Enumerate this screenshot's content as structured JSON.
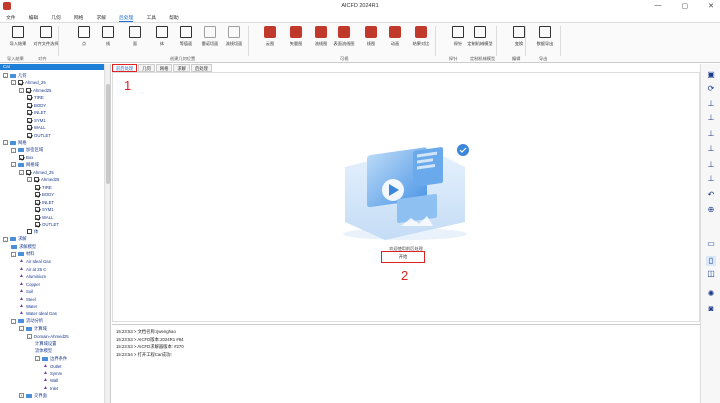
{
  "window": {
    "title": "AICFD 2024R1",
    "controls": [
      "—",
      "▢",
      "✕"
    ]
  },
  "menu": [
    "文件",
    "编辑",
    "几何",
    "网格",
    "求解",
    "后处理",
    "工具",
    "帮助"
  ],
  "menu_active_index": 5,
  "ribbon": {
    "buttons": [
      {
        "label": "导入结果",
        "icon": "import-result-icon"
      },
      {
        "label": "对齐文件选择",
        "icon": "file-select-icon"
      },
      {
        "label": "点",
        "icon": "point-icon"
      },
      {
        "label": "线",
        "icon": "line-icon"
      },
      {
        "label": "面",
        "icon": "plane-icon"
      },
      {
        "label": "体",
        "icon": "volume-icon"
      },
      {
        "label": "等值面",
        "icon": "isosurface-icon"
      },
      {
        "label": "雷诺切面",
        "icon": "slice-icon"
      },
      {
        "label": "流线切面",
        "icon": "streamline-slice-icon"
      },
      {
        "label": "云图",
        "icon": "contour-icon"
      },
      {
        "label": "矢量图",
        "icon": "vector-icon"
      },
      {
        "label": "流线图",
        "icon": "streamline-icon"
      },
      {
        "label": "表面流线图",
        "icon": "surface-streamline-icon"
      },
      {
        "label": "线图",
        "icon": "line-plot-icon"
      },
      {
        "label": "动画",
        "icon": "animation-icon"
      },
      {
        "label": "结果对比",
        "icon": "compare-icon"
      },
      {
        "label": "探针",
        "icon": "probe-icon"
      },
      {
        "label": "定制机械模型",
        "icon": "custom-model-icon"
      },
      {
        "label": "变换",
        "icon": "transform-icon"
      },
      {
        "label": "数据导出",
        "icon": "data-export-icon"
      }
    ],
    "groups": [
      "导入结果",
      "对齐",
      "创建几何位置",
      "可视",
      "探针",
      "定制机械模型",
      "编辑",
      "导出"
    ]
  },
  "left_panel": {
    "header": "Car",
    "tree": [
      {
        "label": "几何",
        "level": 0,
        "kind": "folder",
        "expander": "-"
      },
      {
        "label": "Ahmed_25",
        "level": 1,
        "kind": "check",
        "checked": true,
        "expander": "-"
      },
      {
        "label": "Ahmed25",
        "level": 2,
        "kind": "check",
        "checked": true,
        "expander": "-"
      },
      {
        "label": "TIRE",
        "level": 3,
        "kind": "check",
        "checked": true,
        "swatch": true
      },
      {
        "label": "BODY",
        "level": 3,
        "kind": "check",
        "checked": true,
        "swatch": true
      },
      {
        "label": "INLET",
        "level": 3,
        "kind": "check",
        "checked": true,
        "swatch": true
      },
      {
        "label": "SYM1",
        "level": 3,
        "kind": "check",
        "checked": true,
        "swatch": true
      },
      {
        "label": "WALL",
        "level": 3,
        "kind": "check",
        "checked": true,
        "swatch": true
      },
      {
        "label": "OUTLET",
        "level": 3,
        "kind": "check",
        "checked": true,
        "swatch": true
      },
      {
        "label": "网格",
        "level": 0,
        "kind": "folder",
        "expander": "-"
      },
      {
        "label": "加密区域",
        "level": 1,
        "kind": "folder",
        "expander": "-"
      },
      {
        "label": "Box",
        "level": 2,
        "kind": "check",
        "checked": true
      },
      {
        "label": "网格域",
        "level": 1,
        "kind": "folder",
        "expander": "-"
      },
      {
        "label": "Ahmed_25",
        "level": 2,
        "kind": "check",
        "checked": true,
        "expander": "-"
      },
      {
        "label": "Ahmed25",
        "level": 3,
        "kind": "check",
        "checked": true,
        "expander": "-"
      },
      {
        "label": "TIRE",
        "level": 4,
        "kind": "check",
        "checked": true
      },
      {
        "label": "BODY",
        "level": 4,
        "kind": "check",
        "checked": true
      },
      {
        "label": "INLET",
        "level": 4,
        "kind": "check",
        "checked": true
      },
      {
        "label": "SYM1",
        "level": 4,
        "kind": "check",
        "checked": true
      },
      {
        "label": "WALL",
        "level": 4,
        "kind": "check",
        "checked": true
      },
      {
        "label": "OUTLET",
        "level": 4,
        "kind": "check",
        "checked": true
      },
      {
        "label": "体",
        "level": 3,
        "kind": "check",
        "checked": false
      },
      {
        "label": "求解",
        "level": 0,
        "kind": "folder",
        "expander": "-"
      },
      {
        "label": "求解模型",
        "level": 1,
        "kind": "folder"
      },
      {
        "label": "材料",
        "level": 1,
        "kind": "folder",
        "expander": "-"
      },
      {
        "label": "Air Ideal Gas",
        "level": 2,
        "kind": "material"
      },
      {
        "label": "Air at 25 C",
        "level": 2,
        "kind": "material"
      },
      {
        "label": "Aluminium",
        "level": 2,
        "kind": "material"
      },
      {
        "label": "Copper",
        "level": 2,
        "kind": "material"
      },
      {
        "label": "Soil",
        "level": 2,
        "kind": "material"
      },
      {
        "label": "Steel",
        "level": 2,
        "kind": "material"
      },
      {
        "label": "Water",
        "level": 2,
        "kind": "material"
      },
      {
        "label": "Water Ideal Gas",
        "level": 2,
        "kind": "material"
      },
      {
        "label": "流动分析",
        "level": 1,
        "kind": "folder",
        "expander": "-"
      },
      {
        "label": "计算域",
        "level": 2,
        "kind": "folder",
        "expander": "-"
      },
      {
        "label": "Domain-Ahmed25",
        "level": 3,
        "kind": "text",
        "expander": "-"
      },
      {
        "label": "计算域设置",
        "level": 4,
        "kind": "text"
      },
      {
        "label": "流体模型",
        "level": 4,
        "kind": "text"
      },
      {
        "label": "边界条件",
        "level": 4,
        "kind": "folder",
        "expander": "-"
      },
      {
        "label": "Outlet",
        "level": 5,
        "kind": "boundary"
      },
      {
        "label": "Symm",
        "level": 5,
        "kind": "boundary"
      },
      {
        "label": "Wall",
        "level": 5,
        "kind": "boundary"
      },
      {
        "label": "Inlet",
        "level": 5,
        "kind": "boundary"
      },
      {
        "label": "交界面",
        "level": 2,
        "kind": "folder",
        "expander": "+"
      }
    ]
  },
  "tabs": [
    "前后处理",
    "几何",
    "网格",
    "求解",
    "后处理"
  ],
  "active_tab": 0,
  "main": {
    "caption": "欢迎使用前后处理",
    "start_button": "开始"
  },
  "annotations": [
    "1",
    "2"
  ],
  "log": [
    "15:23:53 > 文档名称:rjwenghao",
    "15:23:53 > AICFD版本:2024R1 #94",
    "15:23:53 > AICFD求解器版本: #270",
    "15:23:54 > 打开工程Car成功!"
  ],
  "right_toolbar": [
    "fit-view-icon",
    "rotate-icon",
    "axis-x-icon",
    "axis-y-icon",
    "axis-z-icon",
    "axis-neg-x-icon",
    "axis-neg-y-icon",
    "axis-neg-z-icon",
    "undo-view-icon",
    "zoom-icon",
    "ruler-icon",
    "measure-icon",
    "layer-icon",
    "palette-icon",
    "camera-icon"
  ],
  "colors": {
    "accent": "#1e7fd6",
    "annotation": "#dd2222",
    "tree_text": "#1a3a8c"
  }
}
